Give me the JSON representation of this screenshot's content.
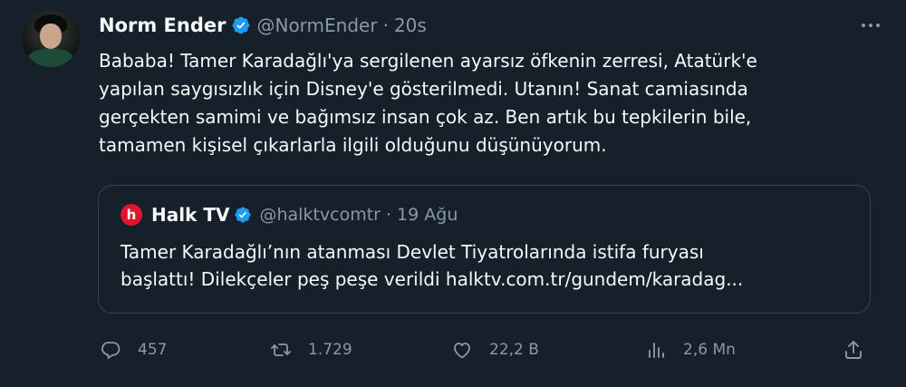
{
  "tweet": {
    "author": {
      "name": "Norm Ender",
      "handle": "@NormEnder",
      "separator": "·",
      "time": "20s",
      "verified": true
    },
    "text_lines": [
      "Bababa! Tamer Karadağlı'ya sergilenen ayarsız öfkenin zerresi, Atatürk'e",
      "yapılan saygısızlık için Disney'e gösterilmedi. Utanın! Sanat camiasında",
      "gerçekten samimi ve bağımsız insan çok az. Ben artık bu tepkilerin bile,",
      "tamamen kişisel çıkarlarla ilgili olduğunu düşünüyorum."
    ],
    "quote": {
      "logo_letter": "h",
      "name": "Halk TV",
      "handle": "@halktvcomtr",
      "separator": "·",
      "time": "19 Ağu",
      "text_lines": [
        "Tamer Karadağlı’nın atanması Devlet Tiyatrolarında istifa furyası",
        "başlattı! Dilekçeler peş peşe verildi halktv.com.tr/gundem/karadag..."
      ]
    },
    "actions": {
      "replies": "457",
      "retweets": "1.729",
      "likes": "22,2 B",
      "views": "2,6 Mn"
    }
  },
  "icons": {
    "more": "more-horizontal-icon",
    "reply": "reply-icon",
    "retweet": "retweet-icon",
    "like": "heart-icon",
    "views": "analytics-icon",
    "share": "share-icon",
    "verified": "verified-badge-icon"
  },
  "colors": {
    "background": "#15202b",
    "text_primary": "#f7f9f9",
    "text_secondary": "#8b98a5",
    "verified_blue": "#1d9bf0",
    "border": "#38444d",
    "halktv_red": "#e0152b"
  }
}
